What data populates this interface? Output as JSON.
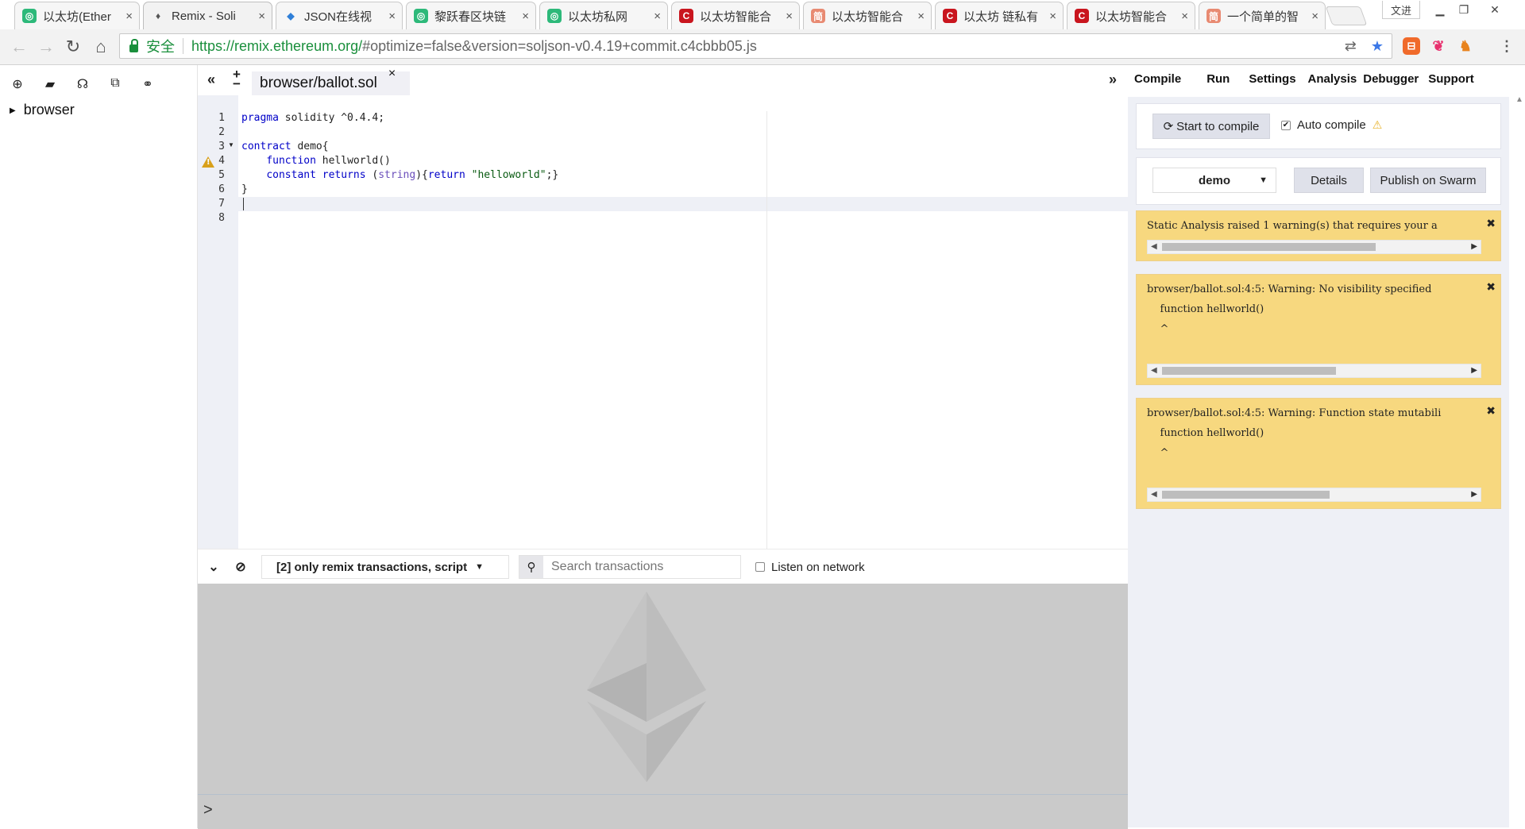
{
  "browser": {
    "tabs": [
      {
        "title": "以太坊(Ether",
        "icon": "green-eth-favicon",
        "color": "#2db97a"
      },
      {
        "title": "Remix - Soli",
        "icon": "remix-favicon",
        "color": "#666666",
        "active": true
      },
      {
        "title": "JSON在线视",
        "icon": "json-favicon",
        "color": "#2f7fd8"
      },
      {
        "title": "黎跃春区块链",
        "icon": "green-eth-favicon",
        "color": "#2db97a"
      },
      {
        "title": "以太坊私网",
        "icon": "green-eth-favicon",
        "color": "#2db97a"
      },
      {
        "title": "以太坊智能合",
        "icon": "csdn-favicon",
        "color": "#c9151e"
      },
      {
        "title": "以太坊智能合",
        "icon": "jianshu-favicon",
        "color": "#e88a72"
      },
      {
        "title": "以太坊 链私有",
        "icon": "csdn-favicon",
        "color": "#c9151e"
      },
      {
        "title": "以太坊智能合",
        "icon": "csdn-favicon",
        "color": "#c9151e"
      },
      {
        "title": "一个简单的智",
        "icon": "jianshu-favicon",
        "color": "#e88a72"
      }
    ],
    "tab_close_glyph": "×",
    "window_label": "文进",
    "secure_label": "安全",
    "url_host": "https://remix.ethereum.org/",
    "url_rest": "#optimize=false&version=soljson-v0.4.19+commit.c4cbbb05.js"
  },
  "file_explorer": {
    "root_label": "browser"
  },
  "editor": {
    "active_file": "browser/ballot.sol",
    "close_glyph": "×",
    "line_numbers": [
      "1",
      "2",
      "3",
      "4",
      "5",
      "6",
      "7",
      "8"
    ],
    "lines": [
      "pragma solidity ^0.4.4;",
      "",
      "contract demo{",
      "    function hellworld()",
      "    constant returns (string){return \"helloworld\";}",
      "}",
      "",
      ""
    ],
    "warning_line": 4
  },
  "terminal": {
    "filter_label": "[2] only remix transactions, script",
    "search_placeholder": "Search transactions",
    "listen_label": "Listen on network",
    "prompt_glyph": ">"
  },
  "right_panel": {
    "tabs": [
      "Compile",
      "Run",
      "Settings",
      "Analysis",
      "Debugger",
      "Support"
    ],
    "active_tab": "Compile",
    "compile_button": "Start to compile",
    "auto_compile_label": "Auto compile",
    "auto_compile_checked": true,
    "contract_selected": "demo",
    "details_button": "Details",
    "publish_button": "Publish on Swarm",
    "alerts": [
      {
        "text": "Static Analysis raised 1 warning(s) that requires your a",
        "scroll_fraction": 0.64
      },
      {
        "text": "browser/ballot.sol:4:5: Warning: No visibility specified\n    function hellworld()\n    ^\n\nSpanning multiple lines.",
        "scroll_fraction": 0.52
      },
      {
        "text": "browser/ballot.sol:4:5: Warning: Function state mutabili\n    function hellworld()\n    ^\n\nSpanning multiple lines.",
        "scroll_fraction": 0.5
      }
    ]
  },
  "colors": {
    "accent_green": "#1a8f3c",
    "warning_bg": "#f7d87f",
    "panel_bg": "#eef0f6"
  }
}
